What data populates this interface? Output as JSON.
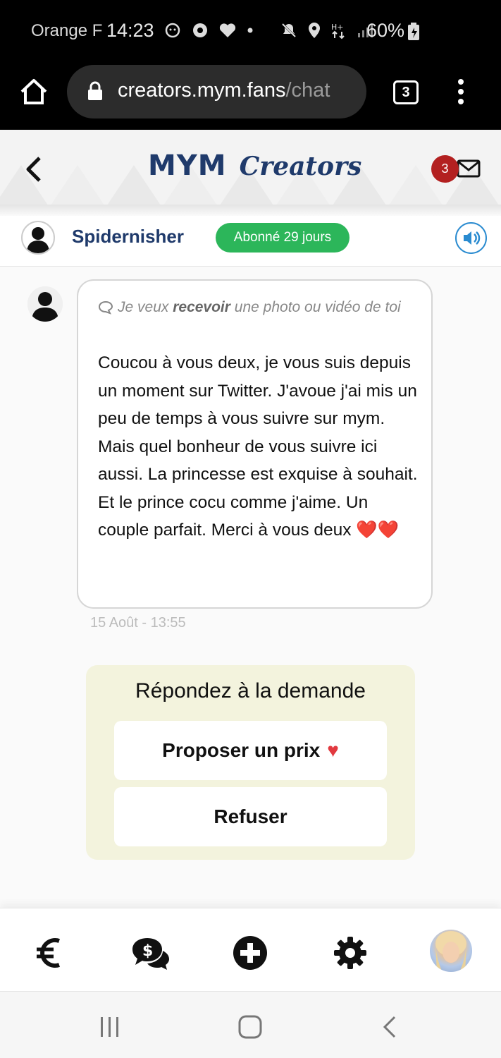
{
  "status_bar": {
    "carrier": "Orange F",
    "time": "14:23",
    "battery": "60%"
  },
  "browser": {
    "url_main": "creators.mym.fans",
    "url_path": "/chat",
    "tab_count": "3"
  },
  "header": {
    "logo_mym": "MYM",
    "logo_creators": "Creators",
    "mail_badge": "3"
  },
  "conversation": {
    "username": "Spidernisher",
    "subscription_badge": "Abonné 29 jours"
  },
  "message": {
    "request_prefix": "Je veux",
    "request_bold": "recevoir",
    "request_suffix": "une photo ou vidéo de toi",
    "text": "Coucou à vous deux, je vous suis depuis un moment sur Twitter. J'avoue j'ai mis un peu de temps à vous suivre sur mym. Mais quel bonheur de vous suivre ici aussi. La princesse est exquise à souhait. Et le prince cocu comme j'aime. Un couple parfait. Merci à vous deux",
    "emoji": "❤️❤️",
    "timestamp": "15 Août - 13:55"
  },
  "respond": {
    "title": "Répondez à la demande",
    "propose_label": "Proposer un prix",
    "refuse_label": "Refuser"
  },
  "colors": {
    "brand_blue": "#1f3a6b",
    "badge_green": "#2cb65a",
    "respond_bg": "#f3f3dd",
    "heart_red": "#e2393f"
  }
}
